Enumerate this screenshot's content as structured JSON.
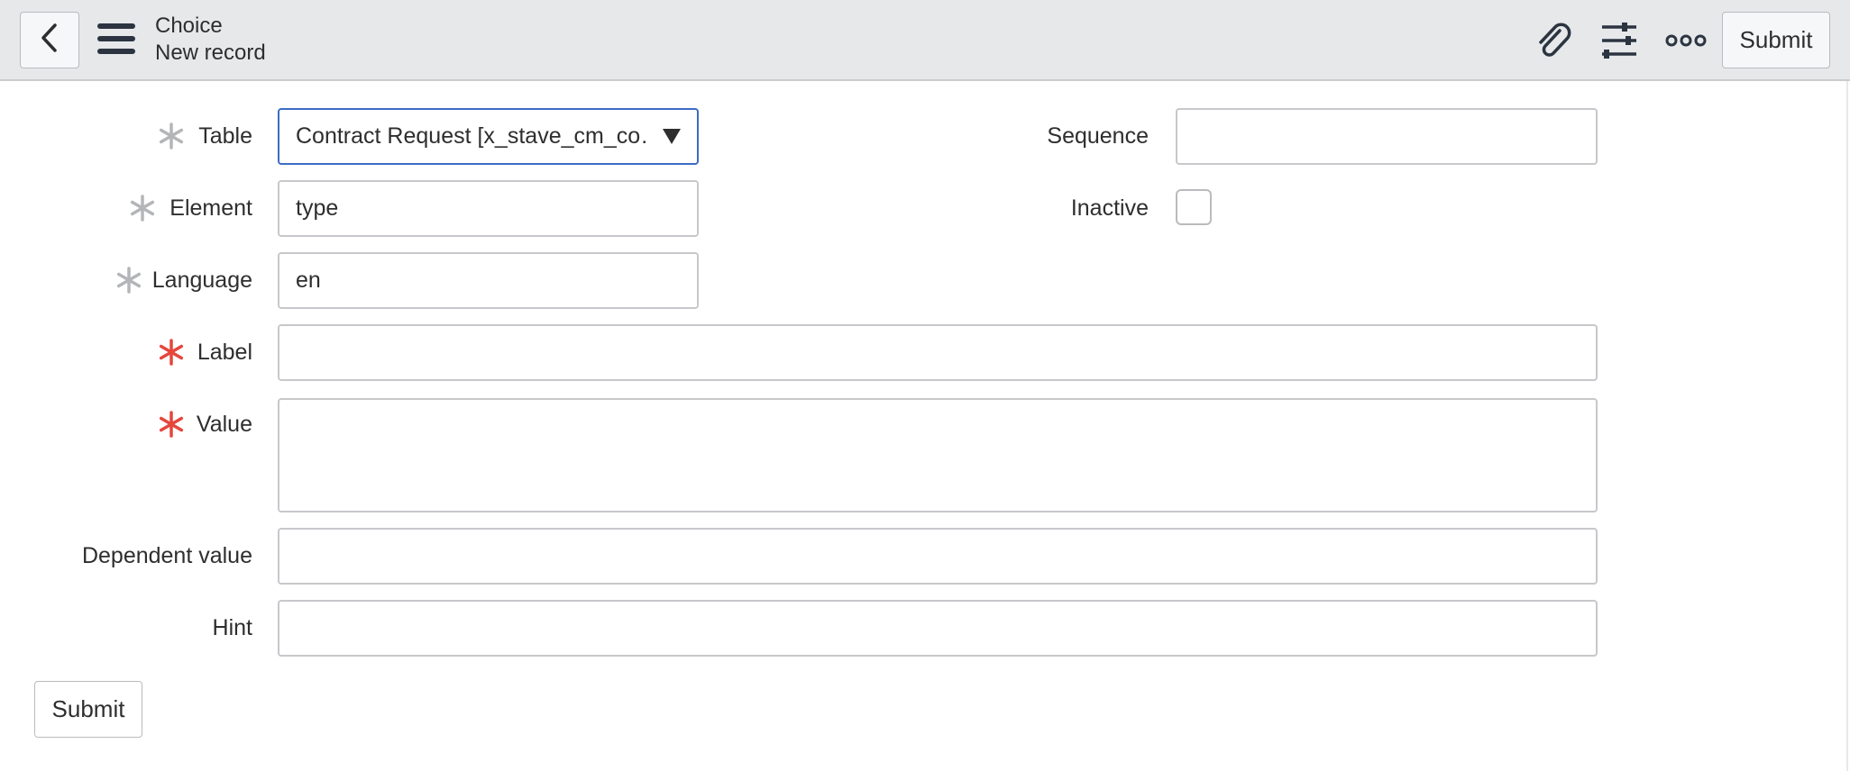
{
  "header": {
    "title": "Choice",
    "subtitle": "New record",
    "back_icon": "chevron-left-icon",
    "menu_icon": "hamburger-menu-icon",
    "attach_icon": "paperclip-icon",
    "settings_icon": "sliders-icon",
    "more_icon": "more-options-icon",
    "submit_label": "Submit"
  },
  "form": {
    "table": {
      "label": "Table",
      "required": "filled",
      "value": "Contract Request [x_stave_cm_co…"
    },
    "element": {
      "label": "Element",
      "required": "filled",
      "value": "type"
    },
    "language": {
      "label": "Language",
      "required": "filled",
      "value": "en"
    },
    "label_field": {
      "label": "Label",
      "required": "mandatory",
      "value": ""
    },
    "value_field": {
      "label": "Value",
      "required": "mandatory",
      "value": ""
    },
    "dependent_value": {
      "label": "Dependent value",
      "value": ""
    },
    "hint": {
      "label": "Hint",
      "value": ""
    },
    "sequence": {
      "label": "Sequence",
      "value": ""
    },
    "inactive": {
      "label": "Inactive",
      "checked": false
    },
    "submit_label": "Submit"
  },
  "colors": {
    "header_bg": "#e6e8ea",
    "required_filled": "#b3b5b8",
    "required_mandatory": "#e5463d",
    "focus_border": "#3d6bc4"
  }
}
